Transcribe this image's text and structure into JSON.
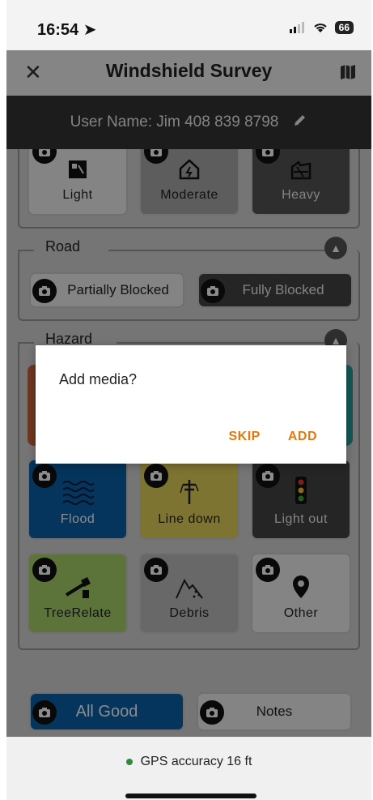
{
  "status_bar": {
    "time": "16:54",
    "battery": "66"
  },
  "nav": {
    "close_glyph": "✕",
    "title": "Windshield Survey"
  },
  "user_bar": {
    "label": "User Name: Jim 408 839 8798"
  },
  "damage_tiles": [
    {
      "label": "Light",
      "bg": "#f0f0f0",
      "fg": "#222"
    },
    {
      "label": "Moderate",
      "bg": "#aaaaaa",
      "fg": "#222"
    },
    {
      "label": "Heavy",
      "bg": "#555555",
      "fg": "#eee"
    }
  ],
  "road": {
    "title": "Road",
    "options": [
      {
        "label": "Partially Blocked",
        "bg": "#f0f0f0",
        "fg": "#222"
      },
      {
        "label": "Fully Blocked",
        "bg": "#444444",
        "fg": "#eee"
      }
    ]
  },
  "hazard": {
    "title": "Hazard",
    "tiles": [
      {
        "label": "Flood",
        "bg": "#0a5fa8",
        "fg": "#fff",
        "icon": "waves-icon"
      },
      {
        "label": "Line  down",
        "bg": "#e6d45a",
        "fg": "#222",
        "icon": "power-line-icon"
      },
      {
        "label": "Light out",
        "bg": "#444444",
        "fg": "#eee",
        "icon": "traffic-light-icon"
      },
      {
        "label": "TreeRelate",
        "bg": "#a8d36a",
        "fg": "#222",
        "icon": "tree-icon"
      },
      {
        "label": "Debris",
        "bg": "#bdbdbd",
        "fg": "#222",
        "icon": "debris-icon"
      },
      {
        "label": "Other",
        "bg": "#f0f0f0",
        "fg": "#222",
        "icon": "location-pin-icon"
      }
    ]
  },
  "bottom_buttons": [
    {
      "label": "All Good",
      "bg": "#0a5fa8",
      "fg": "#fff"
    },
    {
      "label": "Notes",
      "bg": "#f0f0f0",
      "fg": "#222"
    }
  ],
  "dialog": {
    "message": "Add media?",
    "skip_label": "SKIP",
    "add_label": "ADD",
    "accent": "#e07a10"
  },
  "gps": {
    "label": "GPS accuracy 16 ft",
    "dot_color": "#2e8b3c"
  }
}
